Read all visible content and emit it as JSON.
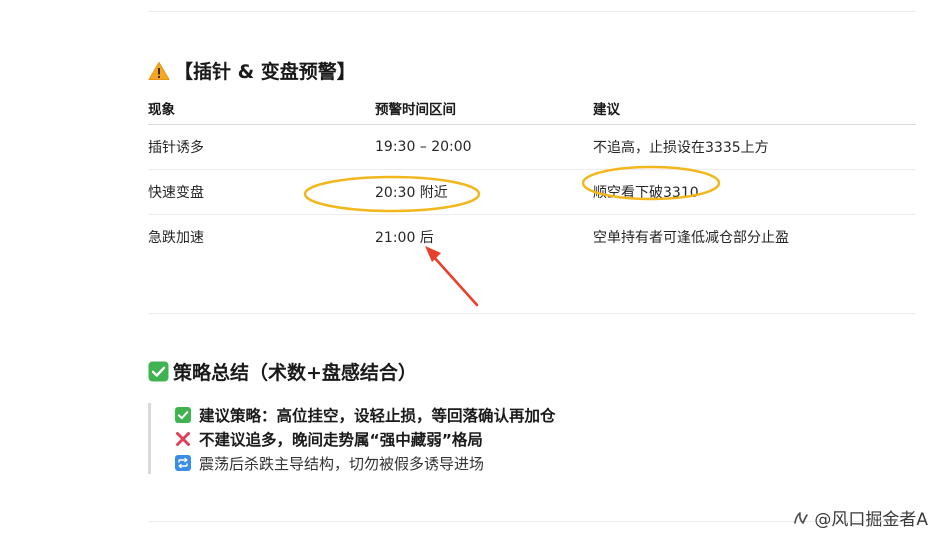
{
  "warning_section": {
    "title": "【插针 & 变盘预警】",
    "icon": "warning-icon",
    "table": {
      "headers": [
        "现象",
        "预警时间区间",
        "建议"
      ],
      "rows": [
        [
          "插针诱多",
          "19:30 – 20:00",
          "不追高，止损设在3335上方"
        ],
        [
          "快速变盘",
          "20:30 附近",
          "顺空看下破3310"
        ],
        [
          "急跌加速",
          "21:00 后",
          "空单持有者可逢低减仓部分止盈"
        ]
      ]
    }
  },
  "strategy_section": {
    "title": "策略总结（术数+盘感结合）",
    "icon": "check-box-icon",
    "items": [
      {
        "icon": "check-box-icon",
        "text": "建议策略：高位挂空，设轻止损，等回落确认再加仓"
      },
      {
        "icon": "cross-mark-icon",
        "text": "不建议追多，晚间走势属“强中藏弱”格局"
      },
      {
        "icon": "repeat-icon",
        "text": "震荡后杀跌主导结构，切勿被假多诱导进场"
      }
    ]
  },
  "watermark": {
    "text": "@风口掘金者A"
  },
  "colors": {
    "annotation_ellipse": "#f2b71c",
    "annotation_arrow": "#e8402a",
    "check_green": "#3eb34f",
    "cross_red": "#e0405a",
    "repeat_blue": "#3b8ee6"
  }
}
